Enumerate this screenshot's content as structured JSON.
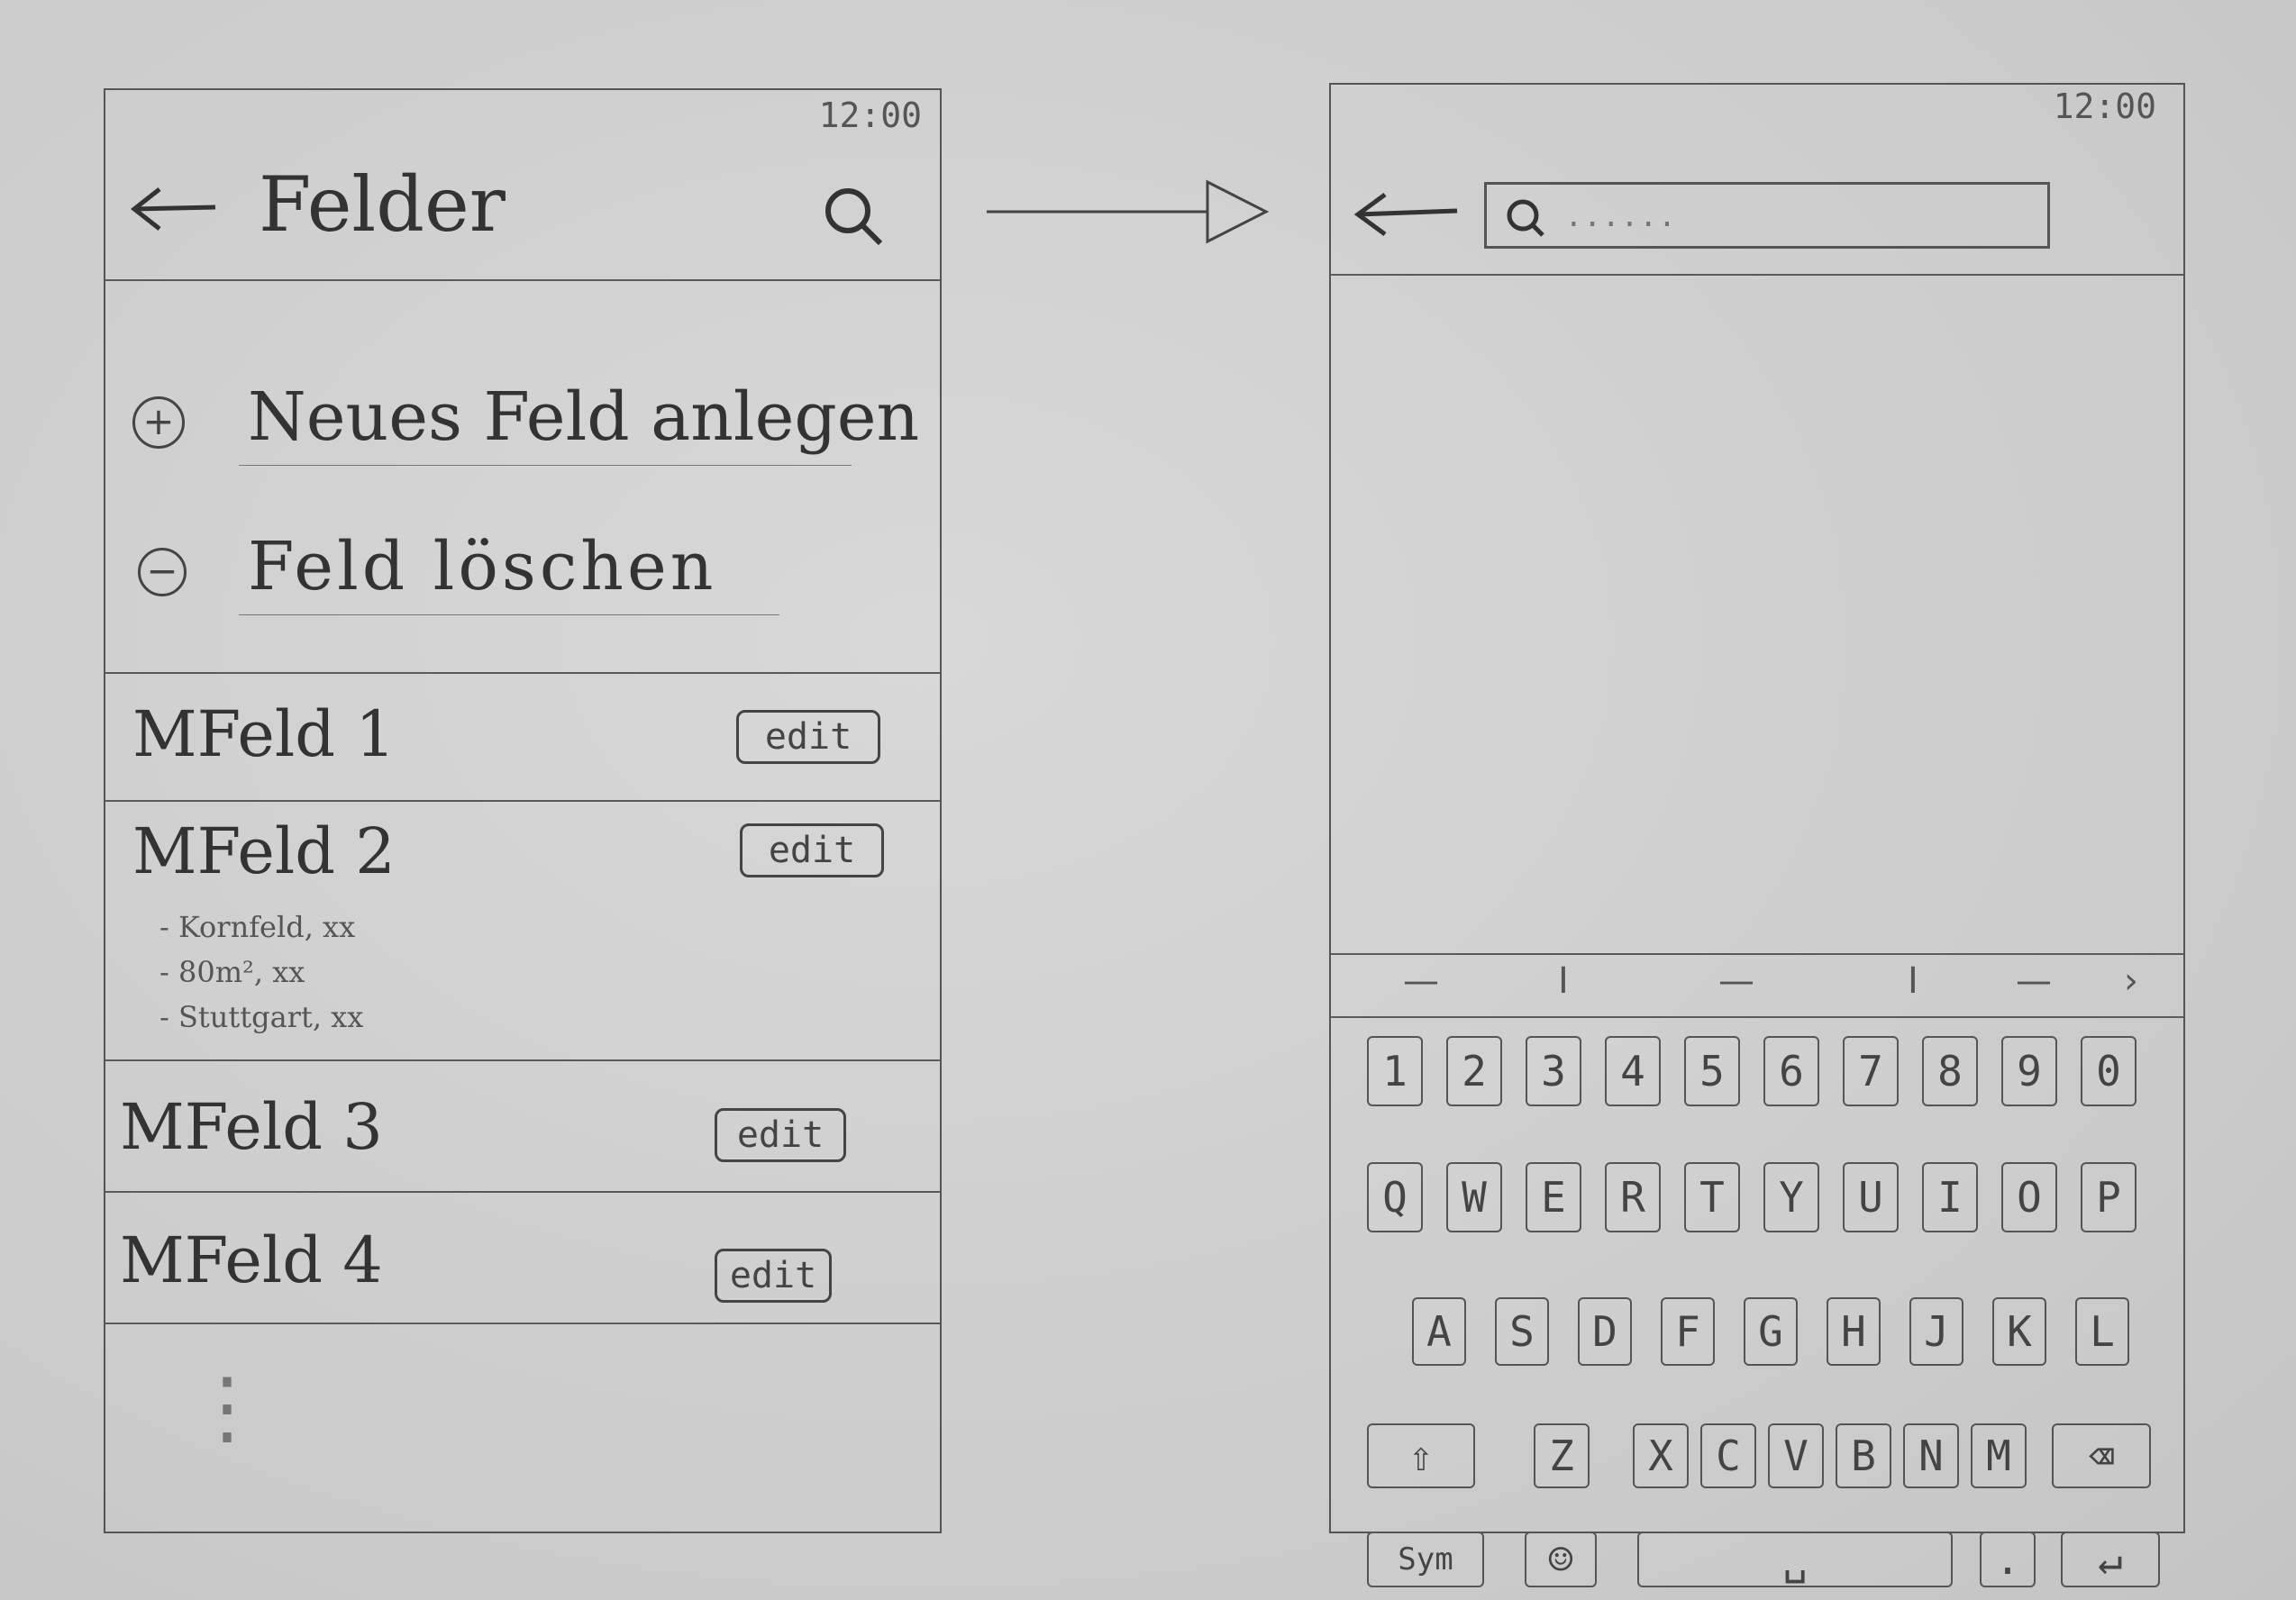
{
  "left_screen": {
    "time": "12:00",
    "title": "Felder",
    "back_icon": "arrow-left-icon",
    "search_icon": "search-icon",
    "actions": [
      {
        "icon": "plus-circle-icon",
        "label": "Neues Feld anlegen"
      },
      {
        "icon": "minus-circle-icon",
        "label": "Feld löschen"
      }
    ],
    "fields": [
      {
        "name": "MFeld 1",
        "edit": "edit"
      },
      {
        "name": "MFeld 2",
        "edit": "edit",
        "details": [
          "- Kornfeld, xx",
          "- 80m², xx",
          "- Stuttgart, xx"
        ]
      },
      {
        "name": "MFeld 3",
        "edit": "edit"
      },
      {
        "name": "MFeld 4",
        "edit": "edit"
      }
    ],
    "more": "⋮"
  },
  "right_screen": {
    "time": "12:00",
    "back_icon": "arrow-left-icon",
    "search_placeholder": "......",
    "suggestions": [
      "—",
      "I",
      "—",
      "I",
      "—",
      "›"
    ],
    "keyboard": {
      "row1": [
        "1",
        "2",
        "3",
        "4",
        "5",
        "6",
        "7",
        "8",
        "9",
        "0"
      ],
      "row2": [
        "Q",
        "W",
        "E",
        "R",
        "T",
        "Y",
        "U",
        "I",
        "O",
        "P"
      ],
      "row3": [
        "A",
        "S",
        "D",
        "F",
        "G",
        "H",
        "J",
        "K",
        "L"
      ],
      "row4": [
        "⇧",
        "Z",
        "X",
        "C",
        "V",
        "B",
        "N",
        "M",
        "⌫"
      ],
      "row5": [
        "Sym",
        "☺",
        "␣",
        ".",
        "↵"
      ]
    }
  }
}
